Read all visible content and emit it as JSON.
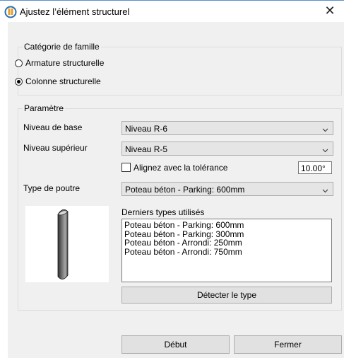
{
  "window": {
    "title": "Ajustez l’élément structurel",
    "close_glyph": "✕"
  },
  "family_category": {
    "legend": "Catégorie de famille",
    "options": [
      {
        "label": "Armature structurelle",
        "checked": false
      },
      {
        "label": "Colonne structurelle",
        "checked": true
      }
    ]
  },
  "parameters": {
    "legend": "Paramètre",
    "base_level": {
      "label": "Niveau de base",
      "value": "Niveau R-6"
    },
    "top_level": {
      "label": "Niveau supérieur",
      "value": "Niveau R-5"
    },
    "align": {
      "label": "Alignez avec la tolérance",
      "checked": false,
      "tolerance": "10.00°"
    },
    "beam_type": {
      "label": "Type de poutre",
      "value": "Poteau béton - Parking: 600mm"
    },
    "recent": {
      "label": "Derniers types utilisés",
      "items": [
        "Poteau béton - Parking: 600mm",
        "Poteau béton - Parking: 300mm",
        "Poteau béton - Arrondi: 250mm",
        "Poteau béton - Arrondi: 750mm"
      ]
    },
    "detect_button": "Détecter le type"
  },
  "footer": {
    "start_button": "Début",
    "close_button": "Fermer"
  },
  "colors": {
    "accent": "#5b8fd0",
    "client_bg": "#f0f0f0",
    "button_bg": "#e1e1e1",
    "combo_bg": "#e5e5e5"
  },
  "icons": {
    "app": "app-logo-icon",
    "close": "close-icon",
    "dropdown": "chevron-down-icon"
  }
}
